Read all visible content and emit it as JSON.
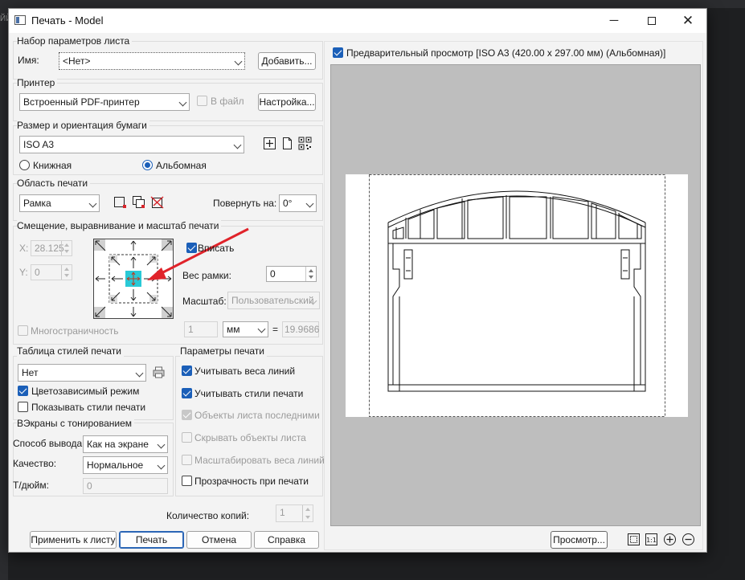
{
  "background": {
    "left_text": "ЙЙ"
  },
  "window": {
    "title": "Печать - Model"
  },
  "page_setup": {
    "section_title": "Набор параметров листа",
    "name_label": "Имя:",
    "name_value": "<Нет>",
    "add_button": "Добавить..."
  },
  "printer": {
    "section_title": "Принтер",
    "value": "Встроенный PDF-принтер",
    "to_file_label": "В файл",
    "settings_button": "Настройка..."
  },
  "paper": {
    "section_title": "Размер и ориентация бумаги",
    "size": "ISO A3",
    "portrait_label": "Книжная",
    "landscape_label": "Альбомная",
    "selected": "Альбомная"
  },
  "print_area": {
    "section_title": "Область печати",
    "value": "Рамка",
    "rotate_label": "Повернуть на:",
    "rotate_value": "0°"
  },
  "offset": {
    "section_title": "Смещение, выравнивание и масштаб печати",
    "x_label": "X:",
    "x_value": "28.125",
    "y_label": "Y:",
    "y_value": "0",
    "fit_label": "Вписать",
    "fit_checked": true,
    "frame_weight_label": "Вес рамки:",
    "frame_weight_value": "0",
    "scale_label": "Масштаб:",
    "scale_value": "Пользовательский",
    "scale_left": "1",
    "scale_unit": "мм",
    "equals": "=",
    "scale_right": "19.9686",
    "multipage_label": "Многостраничность"
  },
  "style_table": {
    "section_title": "Таблица стилей печати",
    "value": "Нет",
    "color_dependent_label": "Цветозависимый режим",
    "color_dependent_checked": true,
    "show_styles_label": "Показывать стили печати",
    "show_styles_checked": false
  },
  "shaded": {
    "section_title": "ВЭкраны с тонированием",
    "mode_label": "Способ вывода:",
    "mode_value": "Как на экране",
    "quality_label": "Качество:",
    "quality_value": "Нормальное",
    "dpi_label": "Т/дюйм:",
    "dpi_value": "0"
  },
  "print_options": {
    "section_title": "Параметры печати",
    "items": [
      {
        "label": "Учитывать веса линий",
        "state": "checked"
      },
      {
        "label": "Учитывать стили печати",
        "state": "checked"
      },
      {
        "label": "Объекты листа последними",
        "state": "disabled-checked"
      },
      {
        "label": "Скрывать объекты листа",
        "state": "disabled"
      },
      {
        "label": "Масштабировать веса линий",
        "state": "disabled"
      },
      {
        "label": "Прозрачность при печати",
        "state": "unchecked"
      }
    ]
  },
  "copies": {
    "label": "Количество копий:",
    "value": "1"
  },
  "buttons": {
    "apply": "Применить к листу",
    "print": "Печать",
    "cancel": "Отмена",
    "help": "Справка"
  },
  "preview": {
    "checkbox_label": "Предварительный просмотр [ISO A3 (420.00 x 297.00 мм) (Альбомная)]",
    "checked": true,
    "preview_button": "Просмотр..."
  },
  "colors": {
    "accent": "#1b5fb8",
    "preview_bg": "#bebebe",
    "cyan_handle": "#29c9d6",
    "red_arrow": "#e0232a"
  }
}
